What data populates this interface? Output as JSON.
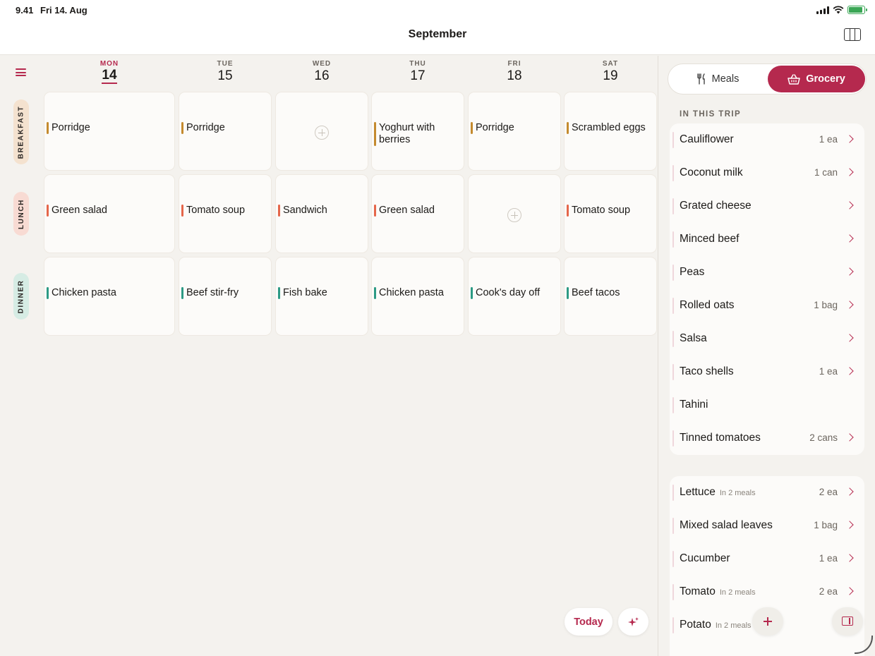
{
  "status": {
    "time": "9.41",
    "date": "Fri 14. Aug"
  },
  "header": {
    "title": "September"
  },
  "days": [
    {
      "name": "MON",
      "num": "14",
      "today": true
    },
    {
      "name": "TUE",
      "num": "15"
    },
    {
      "name": "WED",
      "num": "16"
    },
    {
      "name": "THU",
      "num": "17"
    },
    {
      "name": "FRI",
      "num": "18"
    },
    {
      "name": "SAT",
      "num": "19"
    }
  ],
  "rows": [
    {
      "label": "BREAKFAST",
      "meals": [
        "Porridge",
        "Porridge",
        "",
        "Yoghurt with berries",
        "Porridge",
        "Scrambled eggs"
      ]
    },
    {
      "label": "LUNCH",
      "meals": [
        "Green salad",
        "Tomato soup",
        "Sandwich",
        "Green salad",
        "",
        "Tomato soup"
      ]
    },
    {
      "label": "DINNER",
      "meals": [
        "Chicken pasta",
        "Beef stir-fry",
        "Fish bake",
        "Chicken pasta",
        "Cook's day off",
        "Beef tacos"
      ]
    }
  ],
  "buttons": {
    "today": "Today"
  },
  "tabs": {
    "meals": "Meals",
    "grocery": "Grocery"
  },
  "section": {
    "title": "IN THIS TRIP"
  },
  "trip_items": [
    {
      "name": "Cauliflower",
      "qty": "1 ea",
      "chevron": true
    },
    {
      "name": "Coconut milk",
      "qty": "1 can",
      "chevron": true
    },
    {
      "name": "Grated cheese",
      "qty": "",
      "chevron": true
    },
    {
      "name": "Minced beef",
      "qty": "",
      "chevron": true
    },
    {
      "name": "Peas",
      "qty": "",
      "chevron": true
    },
    {
      "name": "Rolled oats",
      "qty": "1 bag",
      "chevron": true
    },
    {
      "name": "Salsa",
      "qty": "",
      "chevron": true
    },
    {
      "name": "Taco shells",
      "qty": "1 ea",
      "chevron": true
    },
    {
      "name": "Tahini",
      "qty": "",
      "chevron": false
    },
    {
      "name": "Tinned tomatoes",
      "qty": "2 cans",
      "chevron": true
    }
  ],
  "other_items": [
    {
      "name": "Lettuce",
      "sub": "In 2 meals",
      "qty": "2 ea",
      "chevron": true
    },
    {
      "name": "Mixed salad leaves",
      "sub": "",
      "qty": "1 bag",
      "chevron": true
    },
    {
      "name": "Cucumber",
      "sub": "",
      "qty": "1 ea",
      "chevron": true
    },
    {
      "name": "Tomato",
      "sub": "In 2 meals",
      "qty": "2 ea",
      "chevron": true
    },
    {
      "name": "Potato",
      "sub": "In 2 meals",
      "qty": "",
      "chevron": false
    }
  ],
  "colors": {
    "accent": "#b5294e",
    "breakfast": "#c48a2e",
    "lunch": "#e5664a",
    "dinner": "#2c9a84"
  }
}
